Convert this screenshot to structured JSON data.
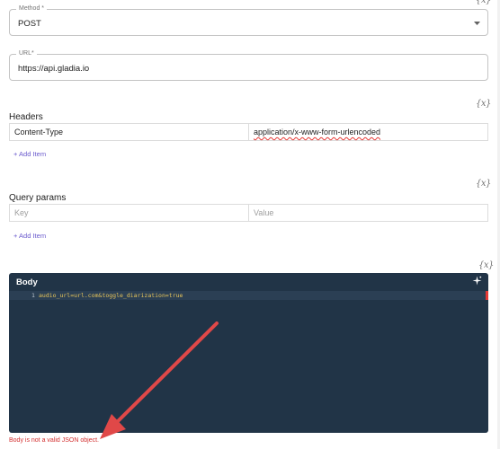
{
  "method": {
    "label": "Method *",
    "value": "POST"
  },
  "url": {
    "label": "URL*",
    "value": "https://api.gladia.io"
  },
  "headers": {
    "label": "Headers",
    "rows": [
      {
        "key": "Content-Type",
        "value": "application/x-www-form-urlencoded"
      }
    ],
    "add_item": "+ Add Item"
  },
  "query_params": {
    "label": "Query params",
    "key_placeholder": "Key",
    "value_placeholder": "Value",
    "add_item": "+ Add Item"
  },
  "body": {
    "title": "Body",
    "line_number": "1",
    "code": "audio_url=url.com&toggle_diarization=true",
    "error": "Body is not a valid JSON object."
  },
  "variable_icon_text": "{x}",
  "colors": {
    "editor_bg": "#213447",
    "accent": "#6a5acd",
    "error": "#d32f2f",
    "arrow": "#e04848"
  }
}
